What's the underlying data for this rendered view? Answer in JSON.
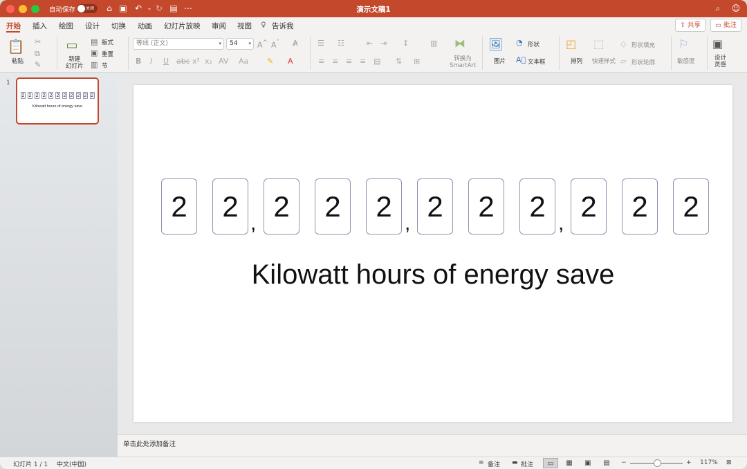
{
  "titlebar": {
    "autosave_label": "自动保存",
    "autosave_state": "关闭",
    "doc_title": "演示文稿1",
    "icons": [
      "home-icon",
      "save-icon",
      "undo-icon",
      "redo-icon",
      "print-icon",
      "more-icon",
      "search-icon",
      "smile-icon"
    ]
  },
  "tabs": [
    "开始",
    "插入",
    "绘图",
    "设计",
    "切换",
    "动画",
    "幻灯片放映",
    "审阅",
    "视图",
    "告诉我"
  ],
  "share_label": "共享",
  "comment_label": "批注",
  "ribbon": {
    "paste": "粘贴",
    "new_slide": "新建\n幻灯片",
    "layout": "版式",
    "reset": "重置",
    "section": "节",
    "font_name": "等线 (正文)",
    "font_size": "54",
    "convert_smartart": "转换为\nSmartArt",
    "picture": "图片",
    "shape": "形状",
    "textbox": "文本框",
    "arrange": "排列",
    "quick_styles": "快速样式",
    "shape_fill": "形状填充",
    "shape_outline": "形状轮廓",
    "sensitivity": "敏感度",
    "design_ideas": "设计\n灵感"
  },
  "thumbnail": {
    "number": "1"
  },
  "slide": {
    "digits": [
      "2",
      "2",
      "2",
      "2",
      "2",
      "2",
      "2",
      "2",
      "2",
      "2",
      "2"
    ],
    "comma": ",",
    "caption": "Kilowatt hours of energy save"
  },
  "notes_placeholder": "单击此处添加备注",
  "status": {
    "slide_count": "幻灯片 1 / 1",
    "language": "中文(中国)",
    "notes": "备注",
    "comments": "批注",
    "zoom": "117%"
  },
  "colors": {
    "accent": "#c4482b",
    "digit_border": "#8e93ad"
  }
}
